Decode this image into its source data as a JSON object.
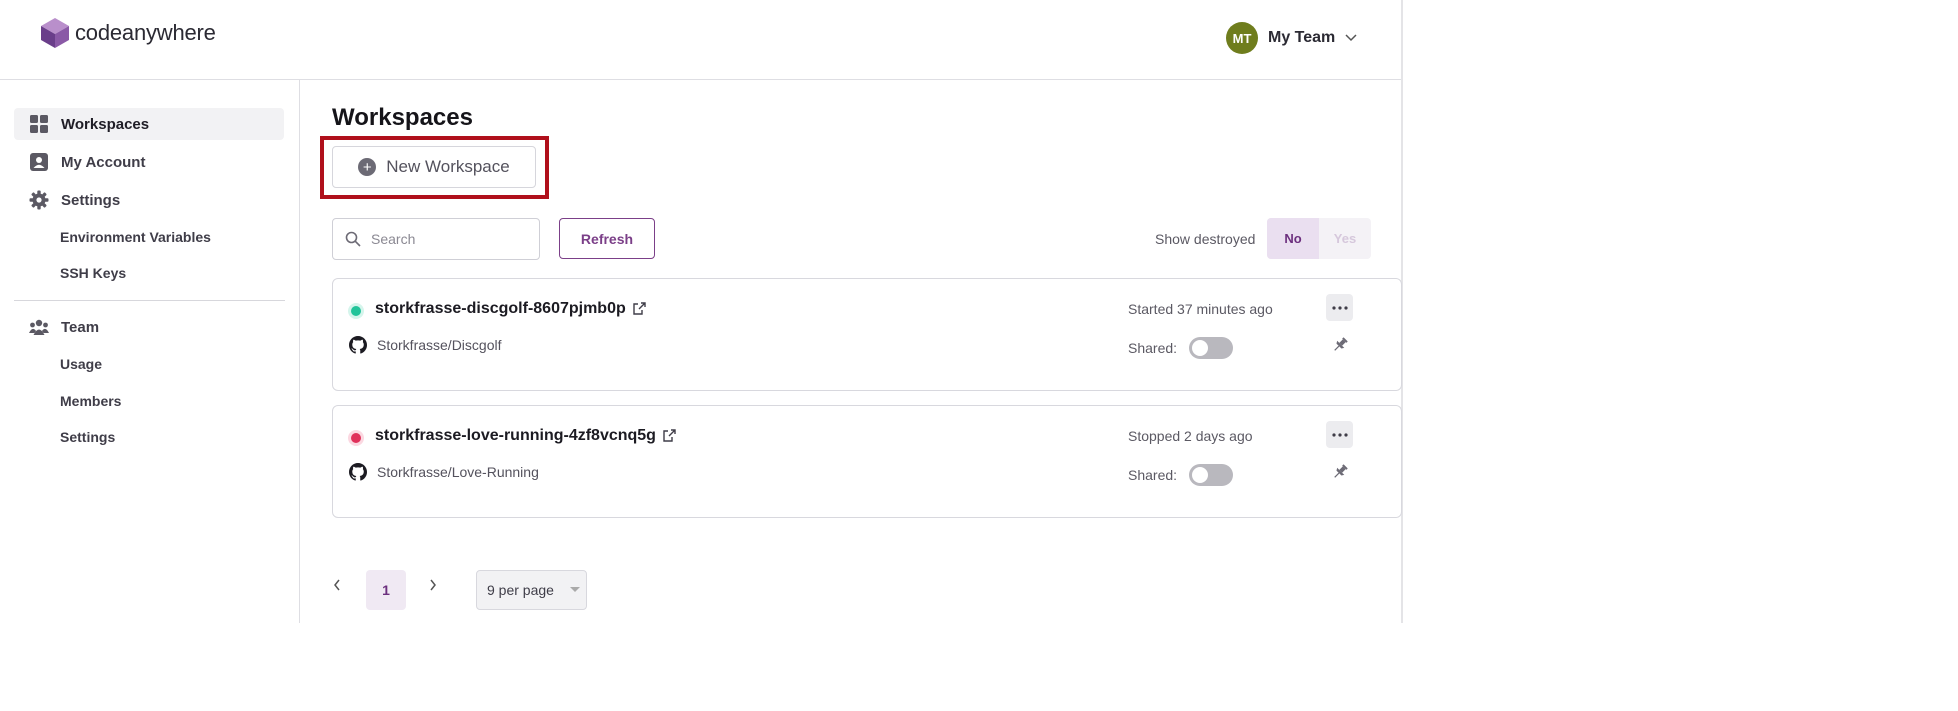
{
  "brand": {
    "name": "codeanywhere",
    "color": "#6a3e8a"
  },
  "team": {
    "initials": "MT",
    "name": "My Team"
  },
  "sidebar": {
    "items": [
      {
        "label": "Workspaces",
        "icon": "grid-icon",
        "active": true
      },
      {
        "label": "My Account",
        "icon": "account-icon"
      },
      {
        "label": "Settings",
        "icon": "gear-icon"
      }
    ],
    "settings_sub": [
      "Environment Variables",
      "SSH Keys"
    ],
    "team": {
      "label": "Team",
      "icon": "team-icon"
    },
    "team_sub": [
      "Usage",
      "Members",
      "Settings"
    ]
  },
  "main": {
    "title": "Workspaces",
    "new_workspace_label": "New Workspace",
    "search_placeholder": "Search",
    "refresh_label": "Refresh",
    "show_destroyed_label": "Show destroyed",
    "show_destroyed_options": [
      "No",
      "Yes"
    ],
    "show_destroyed_selected": "No"
  },
  "workspaces": [
    {
      "name": "storkfrasse-discgolf-8607pjmb0p",
      "repo": "Storkfrasse/Discgolf",
      "status": "Started 37 minutes ago",
      "state": "running",
      "status_color": "#22c49a",
      "shared_label": "Shared:",
      "shared": false
    },
    {
      "name": "storkfrasse-love-running-4zf8vcnq5g",
      "repo": "Storkfrasse/Love-Running",
      "status": "Stopped 2 days ago",
      "state": "stopped",
      "status_color": "#e0305a",
      "shared_label": "Shared:",
      "shared": false
    }
  ],
  "pagination": {
    "current_page": "1",
    "per_page": "9 per page"
  },
  "highlight": {
    "color": "#b0101b",
    "target": "New Workspace"
  }
}
